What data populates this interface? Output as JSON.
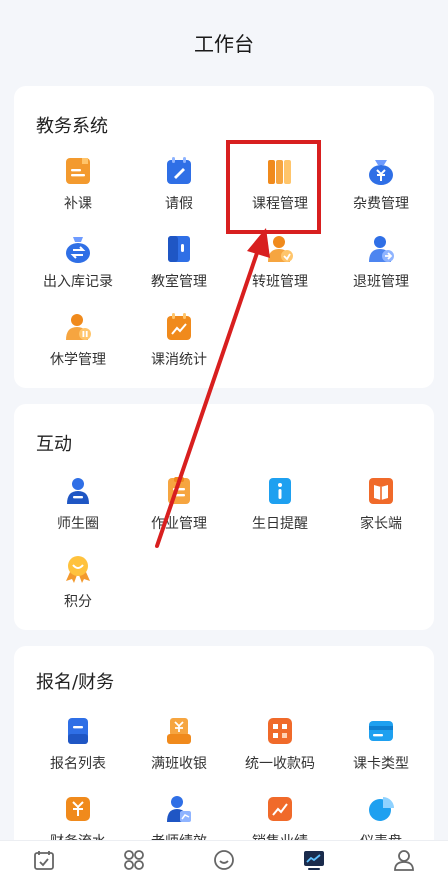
{
  "header": {
    "title": "工作台"
  },
  "sections": {
    "academic": {
      "title": "教务系统",
      "items": [
        {
          "label": "补课",
          "icon": "makeup-class-icon"
        },
        {
          "label": "请假",
          "icon": "leave-request-icon"
        },
        {
          "label": "课程管理",
          "icon": "course-management-icon"
        },
        {
          "label": "杂费管理",
          "icon": "misc-fee-icon"
        },
        {
          "label": "出入库记录",
          "icon": "stock-record-icon"
        },
        {
          "label": "教室管理",
          "icon": "classroom-icon"
        },
        {
          "label": "转班管理",
          "icon": "transfer-class-icon"
        },
        {
          "label": "退班管理",
          "icon": "withdraw-class-icon"
        },
        {
          "label": "休学管理",
          "icon": "suspend-study-icon"
        },
        {
          "label": "课消统计",
          "icon": "class-consumption-chart-icon"
        }
      ]
    },
    "interaction": {
      "title": "互动",
      "items": [
        {
          "label": "师生圈",
          "icon": "teacher-student-circle-icon"
        },
        {
          "label": "作业管理",
          "icon": "homework-icon"
        },
        {
          "label": "生日提醒",
          "icon": "birthday-reminder-icon"
        },
        {
          "label": "家长端",
          "icon": "parent-portal-icon"
        },
        {
          "label": "积分",
          "icon": "points-medal-icon"
        }
      ]
    },
    "finance": {
      "title": "报名/财务",
      "items": [
        {
          "label": "报名列表",
          "icon": "enrollment-list-icon"
        },
        {
          "label": "满班收银",
          "icon": "full-class-cashier-icon"
        },
        {
          "label": "统一收款码",
          "icon": "payment-qr-icon"
        },
        {
          "label": "课卡类型",
          "icon": "course-card-icon"
        },
        {
          "label": "财务流水",
          "icon": "finance-flow-icon"
        },
        {
          "label": "老师绩效",
          "icon": "teacher-performance-icon"
        },
        {
          "label": "销售业绩",
          "icon": "sales-performance-icon"
        },
        {
          "label": "仪表盘",
          "icon": "dashboard-pie-icon"
        }
      ]
    }
  },
  "tabbar": [
    "calendar-tab-icon",
    "apps-tab-icon",
    "smile-tab-icon",
    "workbench-tab-icon",
    "profile-tab-icon"
  ],
  "colors": {
    "accent_blue": "#2f6fe6",
    "accent_orange": "#f08a1c",
    "annotation_red": "#d81f1f"
  }
}
